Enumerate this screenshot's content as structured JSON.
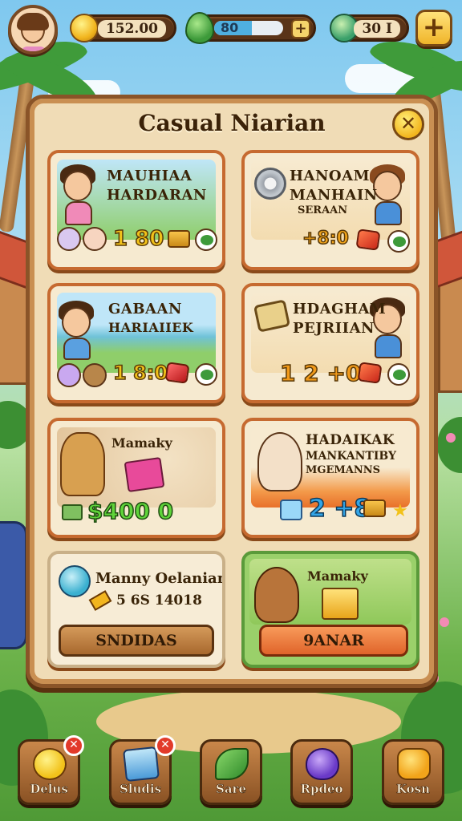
{
  "header": {
    "coins": "152.00",
    "energy": "80",
    "energy_level": 0.55,
    "tokens": "30 I"
  },
  "panel": {
    "title": "Casual Niarian",
    "close_symbol": "✕"
  },
  "cards": [
    {
      "title": "MAUHIAA",
      "subtitle": "HARDARAN",
      "price": "1 80"
    },
    {
      "title": "HANOAM",
      "subtitle": "MANHAIN",
      "tag": "SERAAN",
      "price": "+8:0"
    },
    {
      "title": "GABAAN",
      "subtitle": "HARIAIIEK",
      "price": "1 8:0"
    },
    {
      "title": "HDAGHAM",
      "subtitle": "PEJRIIAN",
      "price": "1 2 +0"
    },
    {
      "title": "Mamaky",
      "price": "$400 0"
    },
    {
      "title": "HADAIKAK",
      "subtitle": "MANKANTIBY",
      "tag": "MGEMANNS",
      "price": "2 +8"
    },
    {
      "title": "Manny Oelanian",
      "price": "5 6S 14018",
      "button": "SNDIDAS"
    },
    {
      "title": "Mamaky",
      "button": "9ANAR"
    }
  ],
  "nav": [
    {
      "label": "Delus",
      "badge": "✕"
    },
    {
      "label": "Sludis",
      "badge": "✕"
    },
    {
      "label": "Sare"
    },
    {
      "label": "Rpdeo"
    },
    {
      "label": "Kosn"
    }
  ],
  "colors": {
    "panel_bg": "#f0dcb6",
    "panel_border": "#8a5428",
    "card_border": "#c66a30",
    "price_gold": "#f2c21a",
    "price_green": "#5fd43a",
    "price_blue": "#33a6e8"
  }
}
